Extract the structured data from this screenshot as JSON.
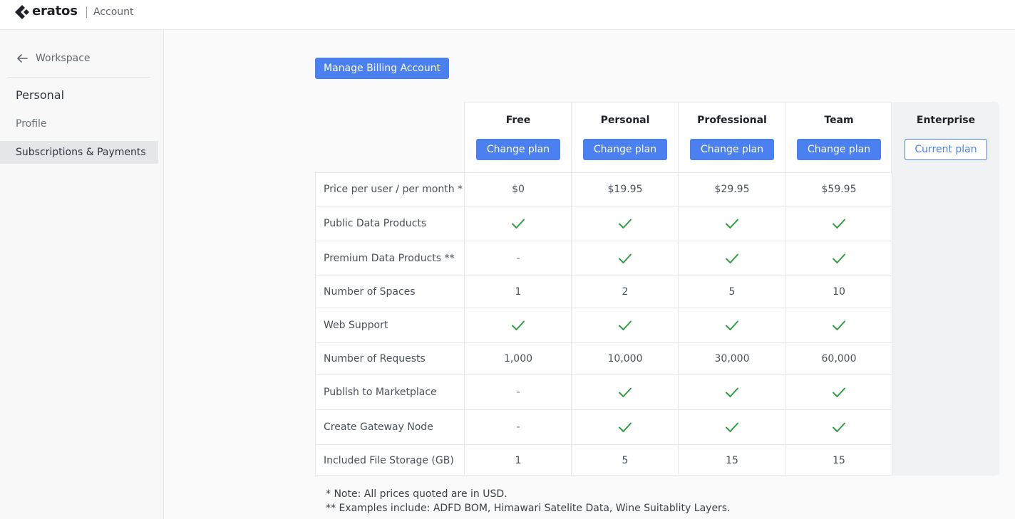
{
  "header": {
    "brand": "eratos",
    "app_name": "Account"
  },
  "sidebar": {
    "back_label": "Workspace",
    "section_title": "Personal",
    "items": [
      {
        "label": "Profile",
        "active": false
      },
      {
        "label": "Subscriptions & Payments",
        "active": true
      }
    ]
  },
  "main": {
    "billing_button": "Manage Billing Account",
    "plans": [
      {
        "name": "Free",
        "action": "Change plan"
      },
      {
        "name": "Personal",
        "action": "Change plan"
      },
      {
        "name": "Professional",
        "action": "Change plan"
      },
      {
        "name": "Team",
        "action": "Change plan"
      },
      {
        "name": "Enterprise",
        "action": "Current plan"
      }
    ],
    "features": [
      {
        "label": "Price per user / per month *",
        "values": [
          "$0",
          "$19.95",
          "$29.95",
          "$59.95"
        ]
      },
      {
        "label": "Public Data Products",
        "values": [
          "check",
          "check",
          "check",
          "check"
        ]
      },
      {
        "label": "Premium Data Products **",
        "values": [
          "-",
          "check",
          "check",
          "check"
        ]
      },
      {
        "label": "Number of Spaces",
        "values": [
          "1",
          "2",
          "5",
          "10"
        ]
      },
      {
        "label": "Web Support",
        "values": [
          "check",
          "check",
          "check",
          "check"
        ]
      },
      {
        "label": "Number of Requests",
        "values": [
          "1,000",
          "10,000",
          "30,000",
          "60,000"
        ]
      },
      {
        "label": "Publish to Marketplace",
        "values": [
          "-",
          "check",
          "check",
          "check"
        ]
      },
      {
        "label": "Create Gateway Node",
        "values": [
          "-",
          "check",
          "check",
          "check"
        ]
      },
      {
        "label": "Included File Storage (GB)",
        "values": [
          "1",
          "5",
          "15",
          "15"
        ]
      }
    ],
    "notes": [
      "* Note: All prices quoted are in USD.",
      "** Examples include: ADFD BOM, Himawari Satelite Data, Wine Suitablity Layers."
    ]
  },
  "colors": {
    "accent": "#4a80f0",
    "check": "#2f9e44",
    "sidebar_bg": "#f8f8f9",
    "active_item_bg": "#e4e6ea"
  },
  "icons": {
    "logo": "eratos-logo-icon",
    "back": "arrow-left-icon",
    "included": "checkmark-icon"
  }
}
